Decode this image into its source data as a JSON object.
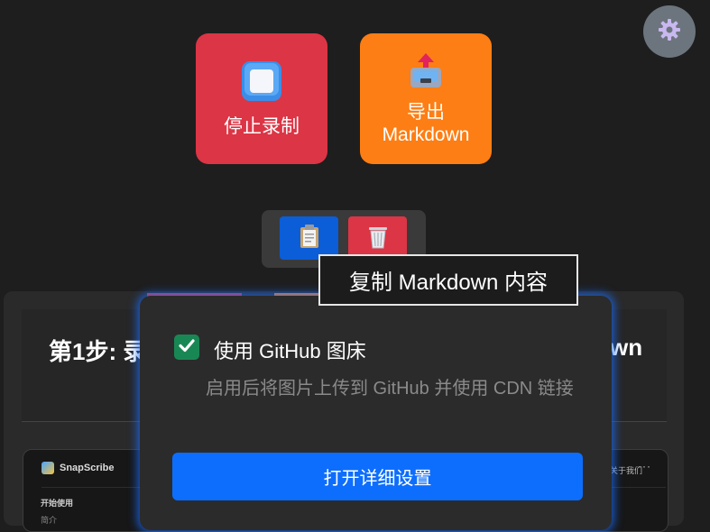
{
  "actions": {
    "stop_label": "停止录制",
    "export_label_line1": "导出",
    "export_label_line2": "Markdown",
    "colors": {
      "stop": "#dc3545",
      "export": "#fd7e14",
      "settings": "#6c757d"
    }
  },
  "settings": {
    "icon": "gear-icon"
  },
  "mini_toolbar": {
    "copy_icon": "clipboard-icon",
    "clear_icon": "trash-icon"
  },
  "tooltip": {
    "text": "复制 Markdown 内容"
  },
  "guide": {
    "title_left": "第1步: 录",
    "title_right": "wn",
    "preview": {
      "app_name": "SnapScribe",
      "section_title": "开始使用",
      "section_sub": "简介",
      "right_text": "关于我们",
      "more": "···"
    }
  },
  "popup": {
    "checkbox_checked": true,
    "checkbox_label": "使用 GitHub 图床",
    "description": "启用后将图片上传到 GitHub 并使用 CDN 链接",
    "button_label": "打开详细设置",
    "accent": "#0d6efd"
  }
}
